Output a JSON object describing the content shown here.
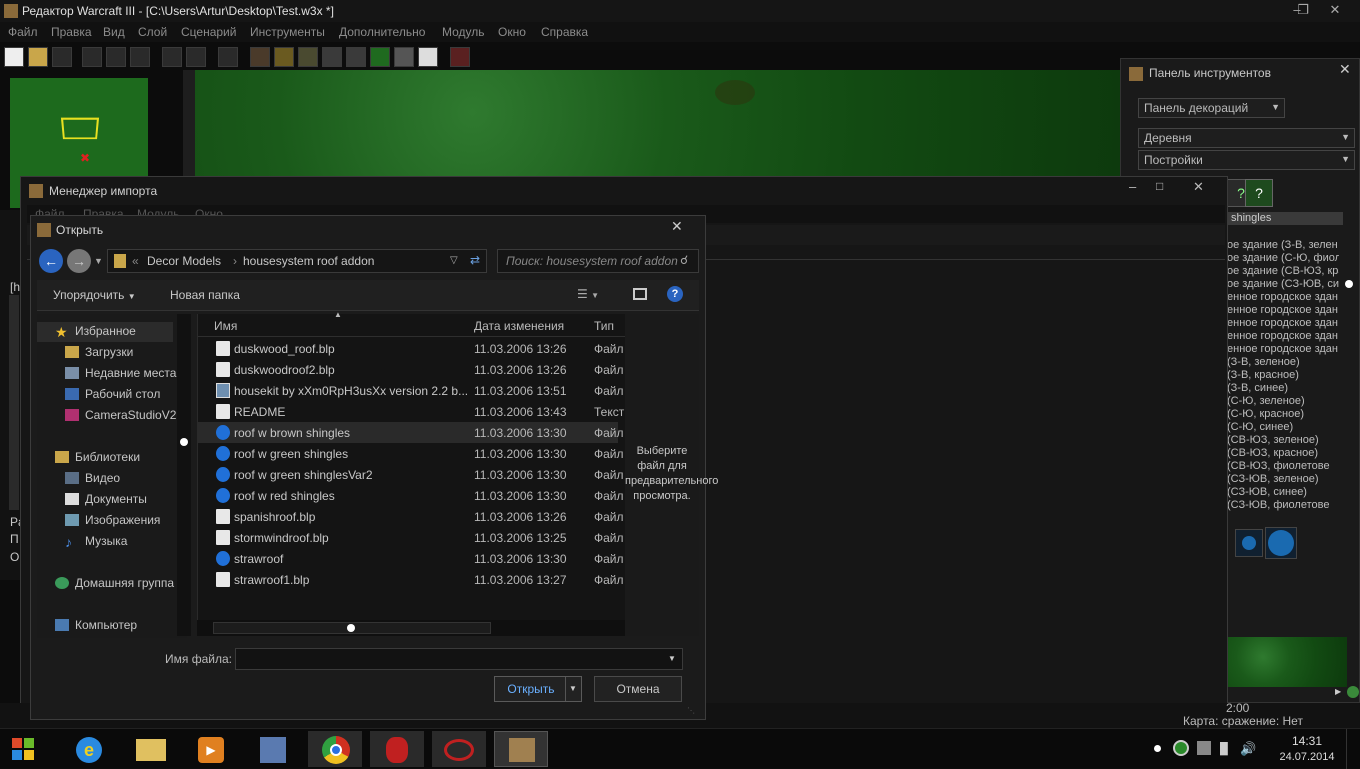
{
  "app": {
    "title": "Редактор Warcraft III - [C:\\Users\\Artur\\Desktop\\Test.w3x *]"
  },
  "menu": [
    "Файл",
    "Правка",
    "Вид",
    "Слой",
    "Сценарий",
    "Инструменты",
    "Дополнительно",
    "Модуль",
    "Окно",
    "Справка"
  ],
  "tool_panel": {
    "title": "Панель инструментов",
    "palette": "Панель декораций",
    "category": "Деревня",
    "subcategory": "Постройки",
    "selected": "shingles",
    "items": [
      "ое здание (З-В, зелен",
      "ое здание (С-Ю, фиоле",
      "ое здание (СВ-ЮЗ, кра",
      "ое здание (СЗ-ЮВ, син",
      "енное городское здан",
      "енное городское здан",
      "енное городское здан",
      "енное городское здан",
      "енное городское здан",
      "(З-В, зеленое)",
      "(З-В, красное)",
      "(З-В, синее)",
      "(С-Ю, зеленое)",
      "(С-Ю, красное)",
      "(С-Ю, синее)",
      "(СВ-ЮЗ, зеленое)",
      "(СВ-ЮЗ, красное)",
      "(СВ-ЮЗ, фиолетове",
      "(СЗ-ЮВ, зеленое)",
      "(СЗ-ЮВ, синее)",
      "(СЗ-ЮВ, фиолетове"
    ]
  },
  "status": {
    "time": "2:00",
    "map_info": "Карта: сражение: Нет"
  },
  "left_side": {
    "labels": [
      "[h",
      "A",
      "Pa",
      "П",
      "О"
    ]
  },
  "import_manager": {
    "title": "Менеджер импорта",
    "menu": [
      "Файл",
      "Правка",
      "Модуль",
      "Окно"
    ]
  },
  "open_dialog": {
    "title": "Открыть",
    "breadcrumb": [
      "Decor Models",
      "housesystem roof addon"
    ],
    "search_placeholder": "Поиск: housesystem roof addon",
    "organize": "Упорядочить",
    "new_folder": "Новая папка",
    "nav": {
      "favorites": "Избранное",
      "fav_items": [
        "Загрузки",
        "Недавние места",
        "Рабочий стол",
        "CameraStudioV2"
      ],
      "libraries": "Библиотеки",
      "lib_items": [
        "Видео",
        "Документы",
        "Изображения",
        "Музыка"
      ],
      "homegroup": "Домашняя группа",
      "computer": "Компьютер"
    },
    "columns": {
      "name": "Имя",
      "date": "Дата изменения",
      "type": "Тип"
    },
    "files": [
      {
        "name": "duskwood_roof.blp",
        "date": "11.03.2006 13:26",
        "type": "Файл",
        "icon": "doc"
      },
      {
        "name": "duskwoodroof2.blp",
        "date": "11.03.2006 13:26",
        "type": "Файл",
        "icon": "doc"
      },
      {
        "name": "housekit by xXm0RpH3usXx version 2.2 b...",
        "date": "11.03.2006 13:51",
        "type": "Файл",
        "icon": "img"
      },
      {
        "name": "README",
        "date": "11.03.2006 13:43",
        "type": "Текст",
        "icon": "doc"
      },
      {
        "name": "roof w brown shingles",
        "date": "11.03.2006 13:30",
        "type": "Файл",
        "icon": "wc"
      },
      {
        "name": "roof w green shingles",
        "date": "11.03.2006 13:30",
        "type": "Файл",
        "icon": "wc"
      },
      {
        "name": "roof w green shinglesVar2",
        "date": "11.03.2006 13:30",
        "type": "Файл",
        "icon": "wc"
      },
      {
        "name": "roof w red shingles",
        "date": "11.03.2006 13:30",
        "type": "Файл",
        "icon": "wc"
      },
      {
        "name": "spanishroof.blp",
        "date": "11.03.2006 13:26",
        "type": "Файл",
        "icon": "doc"
      },
      {
        "name": "stormwindroof.blp",
        "date": "11.03.2006 13:25",
        "type": "Файл",
        "icon": "doc"
      },
      {
        "name": "strawroof",
        "date": "11.03.2006 13:30",
        "type": "Файл",
        "icon": "wc"
      },
      {
        "name": "strawroof1.blp",
        "date": "11.03.2006 13:27",
        "type": "Файл",
        "icon": "doc"
      }
    ],
    "preview_text": "Выберите файл для предварительного просмотра.",
    "filename_label": "Имя файла:",
    "filename_value": "",
    "open_button": "Открыть",
    "cancel_button": "Отмена"
  },
  "taskbar": {
    "time": "14:31",
    "date": "24.07.2014"
  }
}
